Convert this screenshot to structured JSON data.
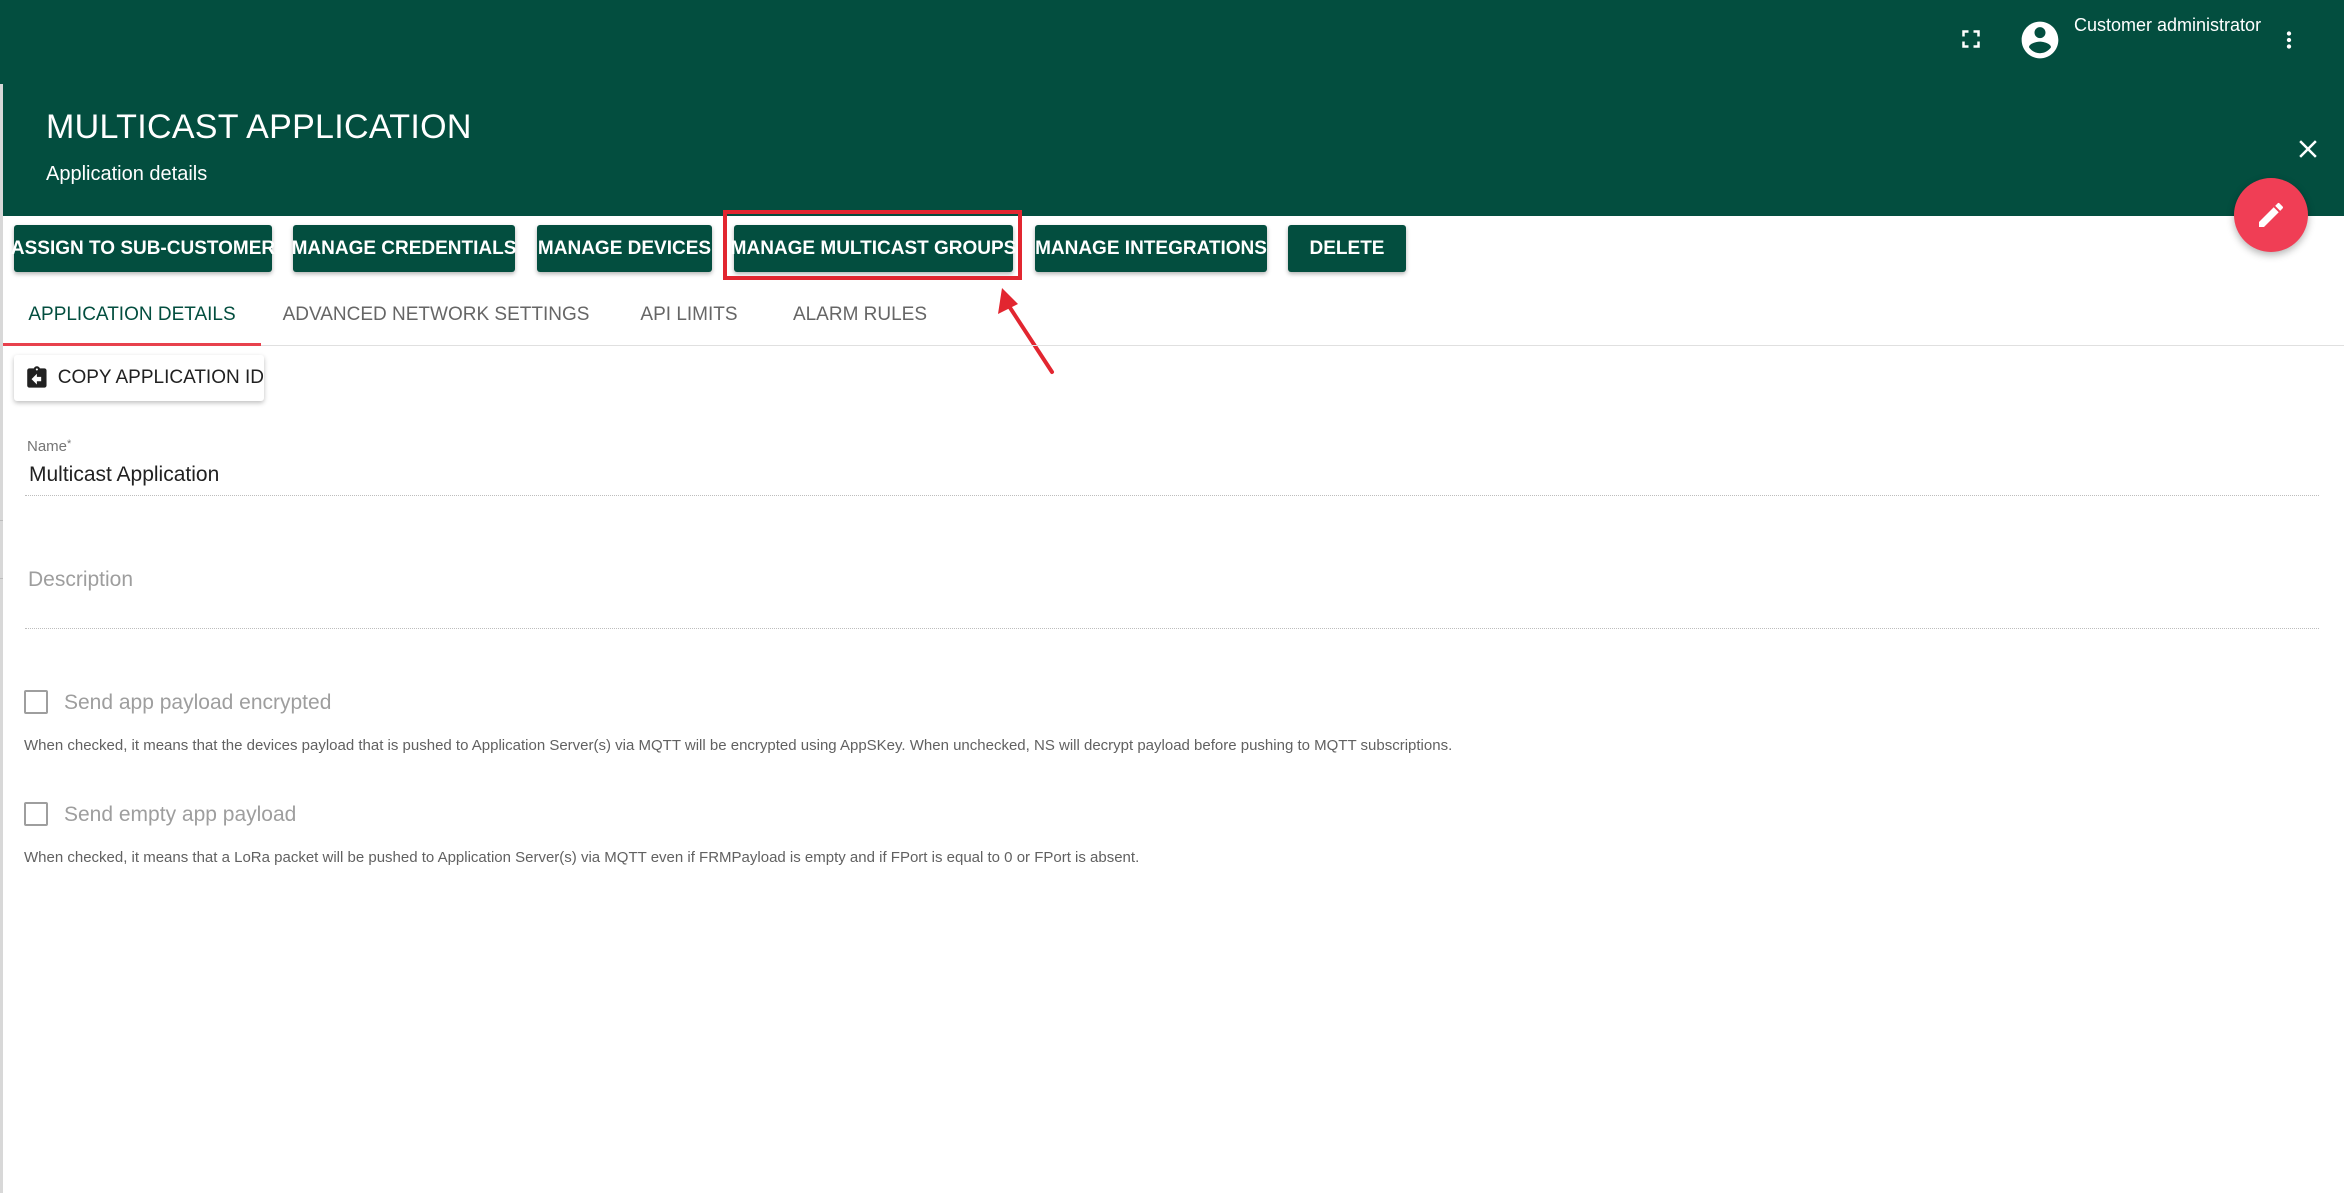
{
  "topbar": {
    "user_name": "Customer administrator",
    "icons": [
      "fullscreen-icon",
      "account-circle-icon",
      "more-vert-icon"
    ]
  },
  "header": {
    "title": "MULTICAST APPLICATION",
    "subtitle": "Application details",
    "icons": [
      "close-icon",
      "edit-pencil-icon"
    ]
  },
  "colors": {
    "brand": "#034e3f",
    "fab": "#f03e55",
    "highlight": "#e22630",
    "tab_ink": "#e8414d"
  },
  "actions": [
    {
      "label": "ASSIGN TO SUB-CUSTOMER"
    },
    {
      "label": "MANAGE CREDENTIALS"
    },
    {
      "label": "MANAGE DEVICES"
    },
    {
      "label": "MANAGE MULTICAST GROUPS",
      "highlighted": true
    },
    {
      "label": "MANAGE INTEGRATIONS"
    },
    {
      "label": "DELETE"
    }
  ],
  "tabs": [
    {
      "label": "APPLICATION DETAILS",
      "active": true
    },
    {
      "label": "ADVANCED NETWORK SETTINGS"
    },
    {
      "label": "API LIMITS"
    },
    {
      "label": "ALARM RULES"
    }
  ],
  "copy_button": {
    "label": "COPY APPLICATION ID",
    "icon": "clipboard-arrow-left-icon"
  },
  "form": {
    "name": {
      "label": "Name",
      "required_mark": "*",
      "value": "Multicast Application"
    },
    "description": {
      "placeholder": "Description",
      "value": ""
    },
    "checkboxes": [
      {
        "label": "Send app payload encrypted",
        "checked": false,
        "hint": "When checked, it means that the devices payload that is pushed to Application Server(s) via MQTT will be encrypted using AppSKey. When unchecked, NS will decrypt payload before pushing to MQTT subscriptions."
      },
      {
        "label": "Send empty app payload",
        "checked": false,
        "hint": "When checked, it means that a LoRa packet will be pushed to Application Server(s) via MQTT even if FRMPayload is empty and if FPort is equal to 0 or FPort is absent."
      }
    ]
  }
}
